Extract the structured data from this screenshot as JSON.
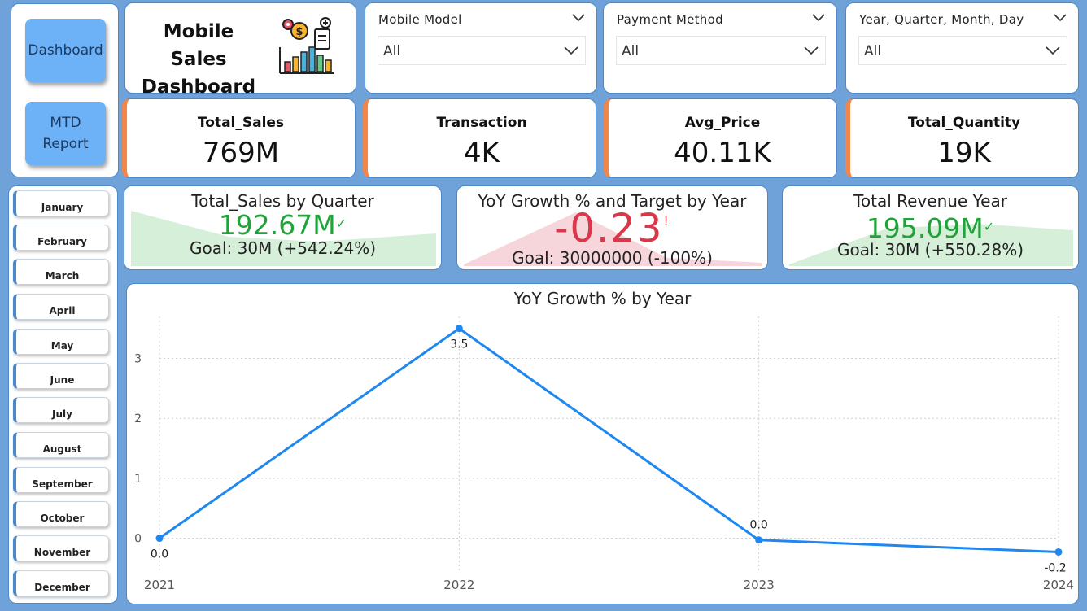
{
  "nav": {
    "dashboard_label": "Dashboard",
    "mtd_label": "MTD\nReport"
  },
  "title": {
    "text": "Mobile Sales\nDashboard",
    "icon": "sales-chart-icon"
  },
  "slicers": {
    "model": {
      "title": "Mobile Model",
      "value": "All"
    },
    "payment": {
      "title": "Payment Method",
      "value": "All"
    },
    "date": {
      "title": "Year, Quarter, Month, Day",
      "value": "All"
    }
  },
  "kpis": {
    "sales": {
      "label": "Total_Sales",
      "value": "769M"
    },
    "transactions": {
      "label": "Transaction",
      "value": "4K"
    },
    "avg_price": {
      "label": "Avg_Price",
      "value": "40.11K"
    },
    "quantity": {
      "label": "Total_Quantity",
      "value": "19K"
    }
  },
  "months": [
    "January",
    "February",
    "March",
    "April",
    "May",
    "June",
    "July",
    "August",
    "September",
    "October",
    "November",
    "December"
  ],
  "gauges": {
    "quarter": {
      "title": "Total_Sales by Quarter",
      "value": "192.67M",
      "status": "✓",
      "goal": "Goal: 30M (+542.24%)"
    },
    "yoy": {
      "title": "YoY Growth % and Target by Year",
      "value": "-0.23",
      "status": "!",
      "goal": "Goal: 30000000 (-100%)"
    },
    "revenue": {
      "title": "Total Revenue Year",
      "value": "195.09M",
      "status": "✓",
      "goal": "Goal: 30M (+550.28%)"
    }
  },
  "colors": {
    "accent": "#1e88f0",
    "positive": "#1fa33a",
    "negative": "#d8384a",
    "kpi_border": "#f0864a"
  },
  "chart_data": {
    "type": "line",
    "title": "YoY Growth % by Year",
    "x": [
      "2021",
      "2022",
      "2023",
      "2024"
    ],
    "series": [
      {
        "values": [
          0.0,
          3.5,
          -0.03,
          -0.23
        ],
        "labels": [
          "0.0",
          "3.5",
          "0.0",
          "-0.2"
        ]
      }
    ],
    "yticks": [
      0,
      1,
      2,
      3
    ],
    "ylim": [
      -0.4,
      3.7
    ],
    "grid": true
  }
}
